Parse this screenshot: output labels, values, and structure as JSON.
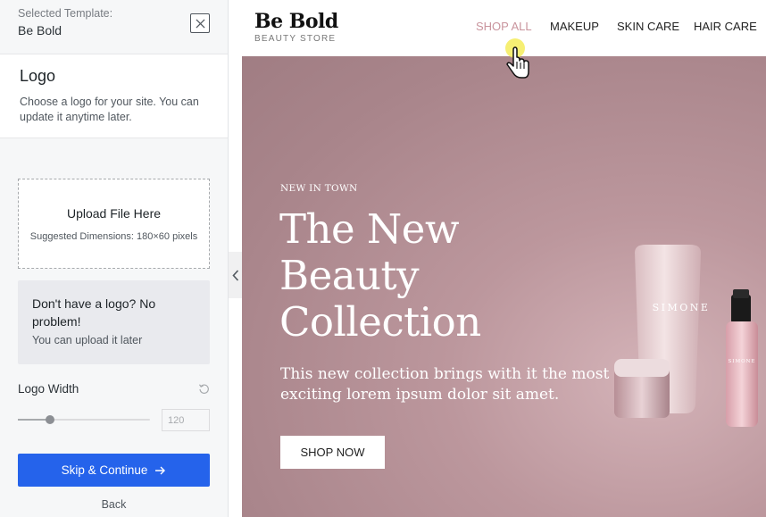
{
  "panel": {
    "selected_label": "Selected Template:",
    "selected_value": "Be Bold",
    "logo": {
      "title": "Logo",
      "description": "Choose a logo for your site. You can update it anytime later."
    },
    "upload": {
      "title": "Upload File Here",
      "dimensions": "Suggested Dimensions: 180×60 pixels"
    },
    "no_logo": {
      "title": "Don't have a logo? No problem!",
      "subtitle": "You can upload it later"
    },
    "logo_width": {
      "label": "Logo Width",
      "value": "120",
      "slider_fraction": 0.24
    },
    "continue_label": "Skip & Continue",
    "back_label": "Back"
  },
  "site": {
    "brand": {
      "name": "Be Bold",
      "tagline": "BEAUTY STORE"
    },
    "nav": [
      {
        "label": "SHOP ALL",
        "active": true
      },
      {
        "label": "MAKEUP",
        "active": false
      },
      {
        "label": "SKIN CARE",
        "active": false
      },
      {
        "label": "HAIR CARE",
        "active": false
      }
    ],
    "hero": {
      "eyebrow": "NEW IN TOWN",
      "title": "The New Beauty Collection",
      "description": "This new collection brings with it the most exciting lorem ipsum dolor sit amet.",
      "button": "SHOP NOW",
      "product_label": "SIMONE"
    }
  },
  "colors": {
    "accent_button": "#2563eb",
    "nav_active": "#c9949d",
    "hero_background": "#b08c92",
    "cursor_highlight": "#f5ec5a"
  },
  "icons": {
    "close": "close-icon",
    "reset": "reset-icon",
    "continue_arrow": "arrow-right-icon",
    "collapse": "chevron-left-icon",
    "cursor": "hand-pointer-icon"
  }
}
